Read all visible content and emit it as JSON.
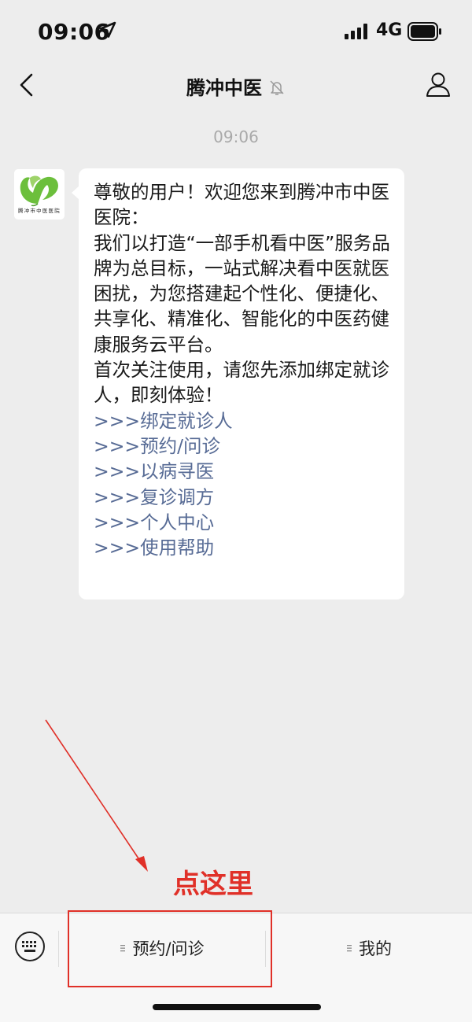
{
  "status_bar": {
    "time": "09:06",
    "network": "4G"
  },
  "nav": {
    "title": "腾冲中医"
  },
  "chat": {
    "timestamp": "09:06",
    "avatar_label": "腾冲市中医医院",
    "message": {
      "paragraphs": [
        "尊敬的用户！欢迎您来到腾冲市中医医院：",
        "我们以打造“一部手机看中医”服务品牌为总目标，一站式解决看中医就医困扰，为您搭建起个性化、便捷化、共享化、精准化、智能化的中医药健康服务云平台。",
        "首次关注使用，请您先添加绑定就诊人，即刻体验！"
      ],
      "links": [
        ">>>绑定就诊人",
        ">>>预约/问诊",
        ">>>以病寻医",
        ">>>复诊调方",
        ">>>个人中心",
        ">>>使用帮助"
      ]
    }
  },
  "annotation": {
    "text": "点这里",
    "color": "#e03028"
  },
  "menu": {
    "items": [
      {
        "label": "预约/问诊"
      },
      {
        "label": "我的"
      }
    ]
  },
  "colors": {
    "link": "#576b95",
    "background": "#ededed",
    "annotation": "#e03028"
  }
}
